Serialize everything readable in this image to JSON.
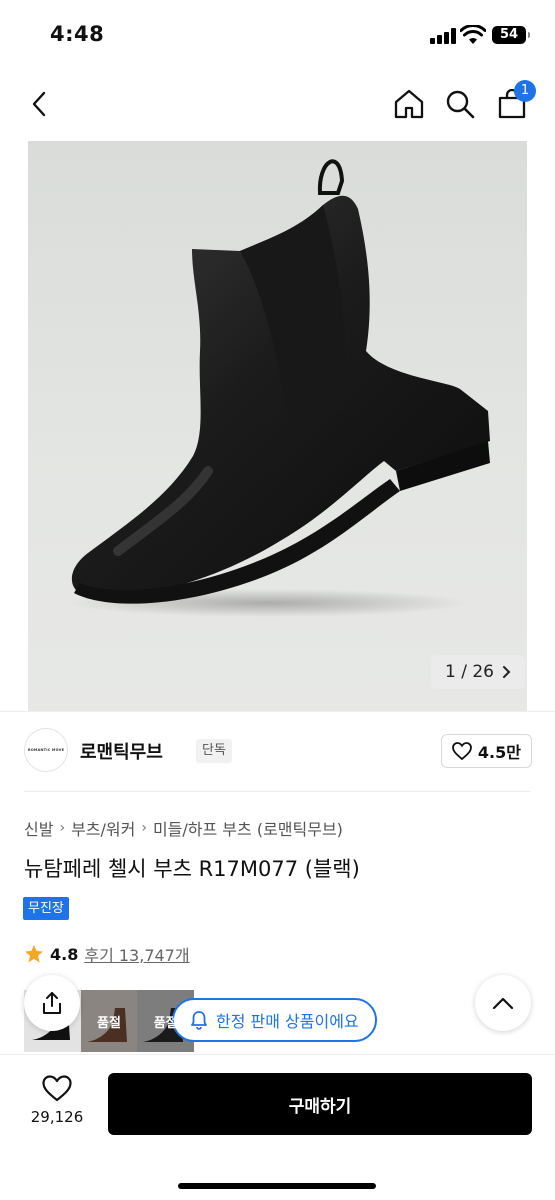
{
  "status_bar": {
    "time": "4:48",
    "battery": "54"
  },
  "header": {
    "cart_count": "1"
  },
  "product_image": {
    "counter": "1 / 26"
  },
  "brand": {
    "logo_text": "ROMANTIC MOVE",
    "name": "로맨틱무브",
    "tag": "단독",
    "likes": "4.5만"
  },
  "breadcrumb": [
    "신발",
    "부츠/워커",
    "미들/하프 부츠 (로맨틱무브)"
  ],
  "product": {
    "title": "뉴탐페레 첼시 부츠 R17M077 (블랙)",
    "badge": "무진장",
    "rating": "4.8",
    "reviews": "후기 13,747개"
  },
  "variants": [
    {
      "label": ""
    },
    {
      "label": "품절"
    },
    {
      "label": "품절"
    }
  ],
  "limited_notice": "한정 판매 상품이에요",
  "bottom": {
    "wish_count": "29,126",
    "buy_label": "구매하기"
  },
  "colors": {
    "accent": "#1e73e8",
    "buy_button": "#000000"
  }
}
